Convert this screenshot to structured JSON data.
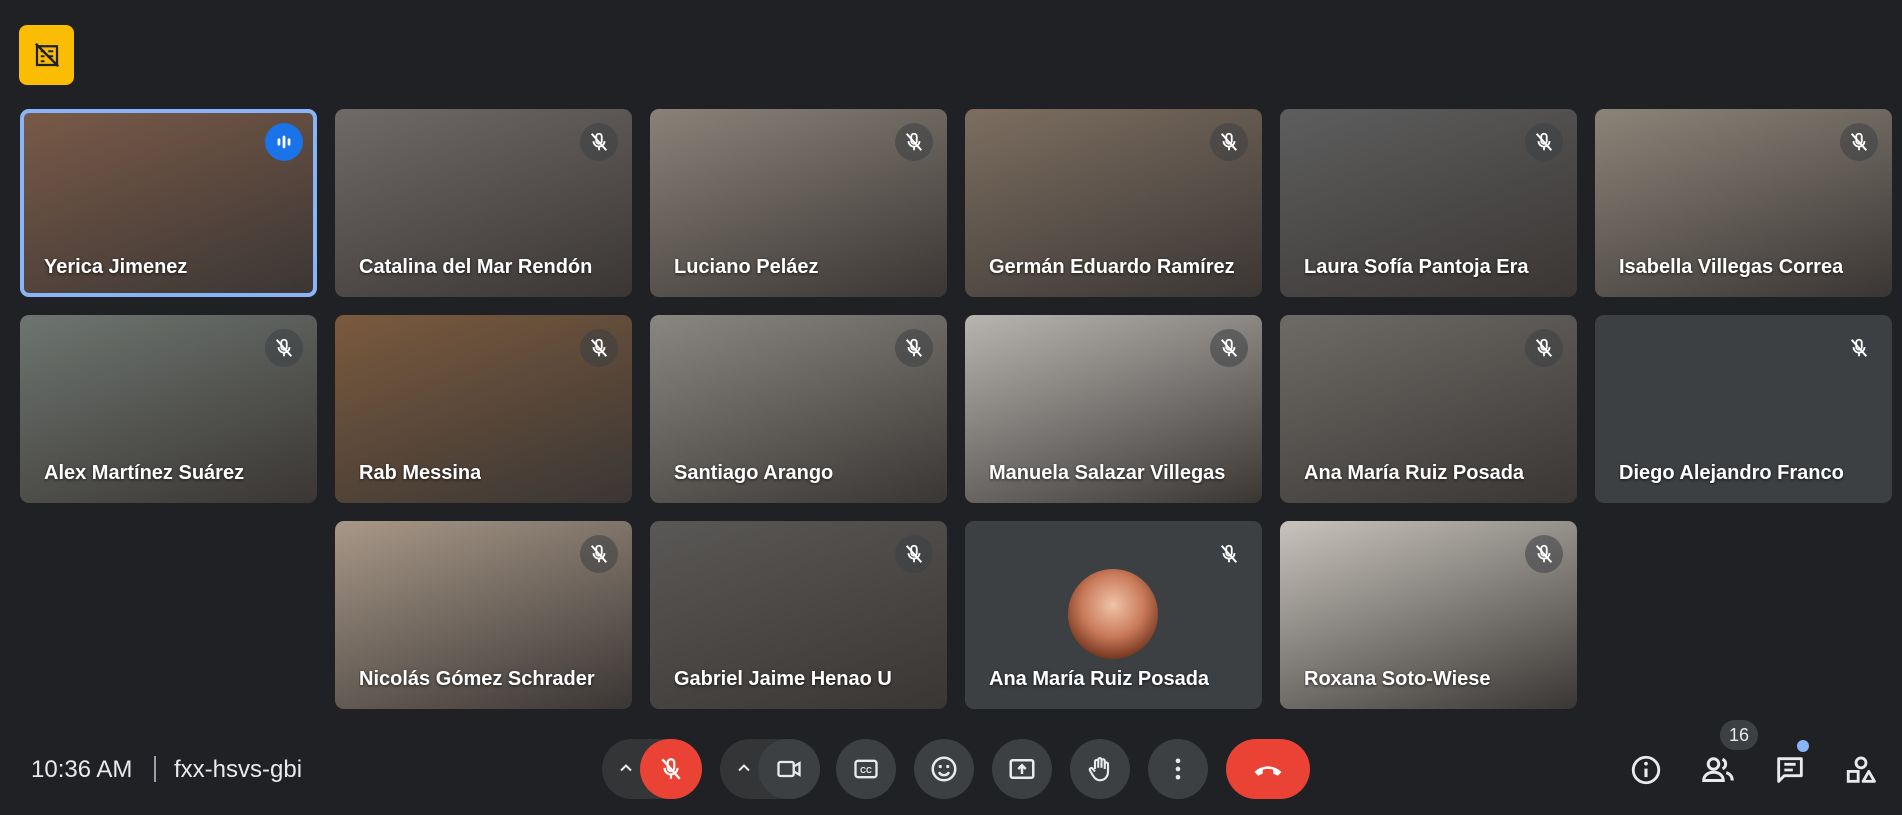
{
  "participants": [
    {
      "name": "Yerica Jimenez",
      "status": "speaking",
      "bg": "#7a5a48"
    },
    {
      "name": "Catalina del Mar Rendón",
      "status": "muted",
      "bg": "#6f6a68"
    },
    {
      "name": "Luciano Peláez",
      "status": "muted",
      "bg": "#8a8278"
    },
    {
      "name": "Germán Eduardo Ramírez",
      "status": "muted",
      "bg": "#7d6e60"
    },
    {
      "name": "Laura Sofía Pantoja Era",
      "status": "muted",
      "bg": "#5e5e5e"
    },
    {
      "name": "Isabella Villegas Correa",
      "status": "muted",
      "bg": "#8b8478"
    },
    {
      "name": "Alex Martínez Suárez",
      "status": "muted",
      "bg": "#6e7570"
    },
    {
      "name": "Rab Messina",
      "status": "muted",
      "bg": "#7a5a3e"
    },
    {
      "name": "Santiago Arango",
      "status": "muted",
      "bg": "#8a8680"
    },
    {
      "name": "Manuela Salazar Villegas",
      "status": "muted",
      "bg": "#b8b4b0"
    },
    {
      "name": "Ana María Ruiz Posada",
      "status": "muted",
      "bg": "#6e6a66"
    },
    {
      "name": "Diego Alejandro Franco",
      "status": "muted",
      "bg": "#3c4043"
    },
    {
      "name": "Nicolás Gómez Schrader",
      "status": "muted",
      "bg": "#a89888"
    },
    {
      "name": "Gabriel Jaime Henao U",
      "status": "muted",
      "bg": "#5a5856"
    },
    {
      "name": "Ana María Ruiz Posada",
      "status": "muted-avatar",
      "bg": "#3c4043"
    },
    {
      "name": "Roxana Soto-Wiese",
      "status": "muted",
      "bg": "#c8c4bc"
    }
  ],
  "bottom_bar": {
    "time": "10:36 AM",
    "meeting_code": "fxx-hsvs-gbi",
    "participant_count": "16"
  },
  "colors": {
    "background": "#202124",
    "active_border": "#8ab4f8",
    "end_call": "#ea4335",
    "recording_badge": "#fbbc04"
  }
}
